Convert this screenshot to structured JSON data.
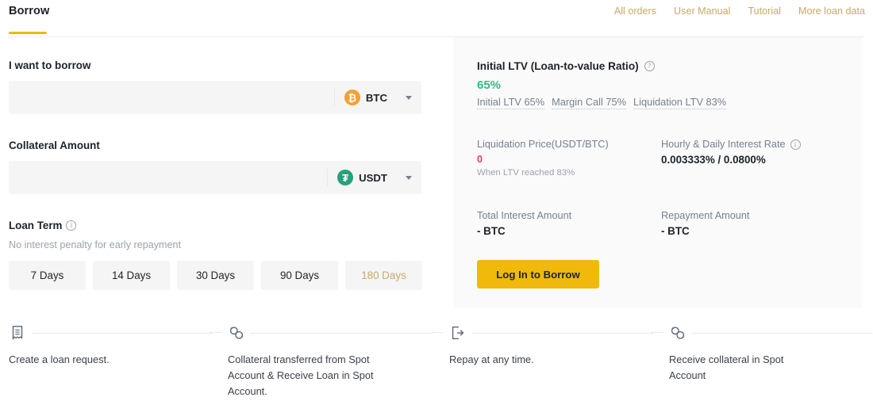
{
  "header": {
    "tab_label": "Borrow",
    "links": [
      {
        "label": "All orders"
      },
      {
        "label": "User Manual"
      },
      {
        "label": "Tutorial"
      },
      {
        "label": "More loan data"
      }
    ]
  },
  "form": {
    "borrow": {
      "label": "I want to borrow",
      "value": "",
      "placeholder": "",
      "asset": "BTC",
      "asset_icon": "btc-coin-icon",
      "asset_symbol": "₿",
      "asset_color": "#f3a036"
    },
    "collateral": {
      "label": "Collateral Amount",
      "value": "",
      "placeholder": "",
      "asset": "USDT",
      "asset_icon": "usdt-coin-icon",
      "asset_symbol": "₮",
      "asset_color": "#26a17b"
    },
    "loan_term": {
      "label": "Loan Term",
      "info_icon": "info-circle-icon",
      "note": "No interest penalty for early repayment",
      "options": [
        {
          "label": "7 Days",
          "selected": false
        },
        {
          "label": "14 Days",
          "selected": false
        },
        {
          "label": "30 Days",
          "selected": false
        },
        {
          "label": "90 Days",
          "selected": false
        },
        {
          "label": "180 Days",
          "selected": true
        }
      ],
      "selected_color": "#c8a96a"
    }
  },
  "panel": {
    "ltv": {
      "title": "Initial LTV (Loan-to-value Ratio)",
      "help_icon": "question-circle-icon",
      "value": "65%",
      "value_color": "#2ebd85",
      "chips": [
        {
          "label": "Initial LTV 65%"
        },
        {
          "label": "Margin Call 75%"
        },
        {
          "label": "Liquidation LTV 83%"
        }
      ]
    },
    "metrics": [
      {
        "label": "Liquidation Price(USDT/BTC)",
        "value": "0",
        "value_color": "#e8405a",
        "sub": "When LTV reached 83%",
        "has_info": false
      },
      {
        "label": "Hourly & Daily Interest Rate",
        "value": "0.003333% / 0.0800%",
        "sub": "",
        "has_info": true,
        "info_icon": "info-circle-icon"
      },
      {
        "label": "Total Interest Amount",
        "value": "- BTC",
        "sub": "",
        "has_info": false
      },
      {
        "label": "Repayment Amount",
        "value": "- BTC",
        "sub": "",
        "has_info": false
      }
    ],
    "cta_label": "Log In to Borrow",
    "cta_color": "#f0b90b"
  },
  "steps": [
    {
      "icon": "receipt-icon",
      "text": "Create a loan request."
    },
    {
      "icon": "transfer-coins-icon",
      "text": "Collateral transferred from Spot Account & Receive Loan in Spot Account."
    },
    {
      "icon": "exit-arrow-icon",
      "text": "Repay at any time."
    },
    {
      "icon": "transfer-coins-icon",
      "text": "Receive collateral in Spot Account"
    }
  ]
}
